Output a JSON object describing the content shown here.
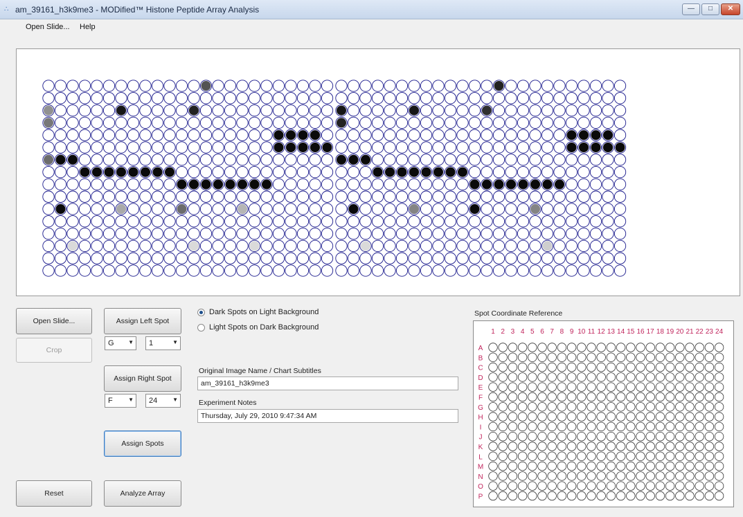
{
  "window": {
    "title": "am_39161_h3k9me3 - MODified™ Histone Peptide Array Analysis",
    "minimize_icon": "minimize-icon",
    "maximize_icon": "maximize-icon",
    "close_icon": "close-icon"
  },
  "menu": {
    "open_slide": "Open Slide...",
    "help": "Help"
  },
  "buttons": {
    "open_slide": "Open Slide...",
    "crop": "Crop",
    "assign_left_spot": "Assign Left Spot",
    "assign_right_spot": "Assign Right Spot",
    "assign_spots": "Assign Spots",
    "reset": "Reset",
    "analyze_array": "Analyze Array"
  },
  "selects": {
    "left_row": "G",
    "left_col": "1",
    "right_row": "F",
    "right_col": "24"
  },
  "radios": {
    "dark_spots": {
      "label": "Dark Spots on Light Background",
      "checked": true
    },
    "light_spots": {
      "label": "Light Spots on Dark Background",
      "checked": false
    }
  },
  "fields": {
    "image_name_label": "Original Image Name / Chart Subtitles",
    "image_name_value": "am_39161_h3k9me3",
    "notes_label": "Experiment Notes",
    "notes_value": "Thursday, July 29, 2010 9:47:34 AM"
  },
  "reference": {
    "title": "Spot Coordinate Reference",
    "columns": [
      "1",
      "2",
      "3",
      "4",
      "5",
      "6",
      "7",
      "8",
      "9",
      "10",
      "11",
      "12",
      "13",
      "14",
      "15",
      "16",
      "17",
      "18",
      "19",
      "20",
      "21",
      "22",
      "23",
      "24"
    ],
    "rows": [
      "A",
      "B",
      "C",
      "D",
      "E",
      "F",
      "G",
      "H",
      "I",
      "J",
      "K",
      "L",
      "M",
      "N",
      "O",
      "P"
    ],
    "label_color": "#c0245c"
  },
  "slide": {
    "rows": 16,
    "cols": 24,
    "ring_color": "#1a1a8c",
    "left_array_spots": [
      {
        "r": 0,
        "c": 13,
        "v": 0.7
      },
      {
        "r": 2,
        "c": 0,
        "v": 0.45
      },
      {
        "r": 2,
        "c": 6,
        "v": 0.95
      },
      {
        "r": 2,
        "c": 12,
        "v": 0.9
      },
      {
        "r": 3,
        "c": 0,
        "v": 0.55
      },
      {
        "r": 4,
        "c": 19,
        "v": 1
      },
      {
        "r": 4,
        "c": 20,
        "v": 1
      },
      {
        "r": 4,
        "c": 21,
        "v": 1
      },
      {
        "r": 4,
        "c": 22,
        "v": 1
      },
      {
        "r": 5,
        "c": 19,
        "v": 1
      },
      {
        "r": 5,
        "c": 20,
        "v": 1
      },
      {
        "r": 5,
        "c": 21,
        "v": 1
      },
      {
        "r": 5,
        "c": 22,
        "v": 1
      },
      {
        "r": 5,
        "c": 23,
        "v": 1
      },
      {
        "r": 6,
        "c": 0,
        "v": 0.6
      },
      {
        "r": 6,
        "c": 1,
        "v": 1
      },
      {
        "r": 6,
        "c": 2,
        "v": 1
      },
      {
        "r": 7,
        "c": 3,
        "v": 1
      },
      {
        "r": 7,
        "c": 4,
        "v": 1
      },
      {
        "r": 7,
        "c": 5,
        "v": 1
      },
      {
        "r": 7,
        "c": 6,
        "v": 1
      },
      {
        "r": 7,
        "c": 7,
        "v": 1
      },
      {
        "r": 7,
        "c": 8,
        "v": 1
      },
      {
        "r": 7,
        "c": 9,
        "v": 1
      },
      {
        "r": 7,
        "c": 10,
        "v": 1
      },
      {
        "r": 8,
        "c": 11,
        "v": 1
      },
      {
        "r": 8,
        "c": 12,
        "v": 1
      },
      {
        "r": 8,
        "c": 13,
        "v": 1
      },
      {
        "r": 8,
        "c": 14,
        "v": 1
      },
      {
        "r": 8,
        "c": 15,
        "v": 1
      },
      {
        "r": 8,
        "c": 16,
        "v": 1
      },
      {
        "r": 8,
        "c": 17,
        "v": 1
      },
      {
        "r": 8,
        "c": 18,
        "v": 1
      },
      {
        "r": 10,
        "c": 1,
        "v": 1
      },
      {
        "r": 10,
        "c": 6,
        "v": 0.35
      },
      {
        "r": 10,
        "c": 11,
        "v": 0.6
      },
      {
        "r": 10,
        "c": 16,
        "v": 0.3
      },
      {
        "r": 13,
        "c": 2,
        "v": 0.15
      },
      {
        "r": 13,
        "c": 12,
        "v": 0.15
      },
      {
        "r": 13,
        "c": 17,
        "v": 0.15
      }
    ],
    "right_array_spots": [
      {
        "r": 0,
        "c": 13,
        "v": 0.9
      },
      {
        "r": 2,
        "c": 0,
        "v": 0.95
      },
      {
        "r": 2,
        "c": 6,
        "v": 0.95
      },
      {
        "r": 2,
        "c": 12,
        "v": 0.85
      },
      {
        "r": 3,
        "c": 0,
        "v": 0.9
      },
      {
        "r": 4,
        "c": 19,
        "v": 1
      },
      {
        "r": 4,
        "c": 20,
        "v": 1
      },
      {
        "r": 4,
        "c": 21,
        "v": 1
      },
      {
        "r": 4,
        "c": 22,
        "v": 1
      },
      {
        "r": 5,
        "c": 19,
        "v": 1
      },
      {
        "r": 5,
        "c": 20,
        "v": 1
      },
      {
        "r": 5,
        "c": 21,
        "v": 1
      },
      {
        "r": 5,
        "c": 22,
        "v": 1
      },
      {
        "r": 5,
        "c": 23,
        "v": 1
      },
      {
        "r": 6,
        "c": 0,
        "v": 1
      },
      {
        "r": 6,
        "c": 1,
        "v": 1
      },
      {
        "r": 6,
        "c": 2,
        "v": 1
      },
      {
        "r": 7,
        "c": 3,
        "v": 1
      },
      {
        "r": 7,
        "c": 4,
        "v": 1
      },
      {
        "r": 7,
        "c": 5,
        "v": 1
      },
      {
        "r": 7,
        "c": 6,
        "v": 1
      },
      {
        "r": 7,
        "c": 7,
        "v": 1
      },
      {
        "r": 7,
        "c": 8,
        "v": 1
      },
      {
        "r": 7,
        "c": 9,
        "v": 1
      },
      {
        "r": 7,
        "c": 10,
        "v": 1
      },
      {
        "r": 8,
        "c": 11,
        "v": 1
      },
      {
        "r": 8,
        "c": 12,
        "v": 1
      },
      {
        "r": 8,
        "c": 13,
        "v": 1
      },
      {
        "r": 8,
        "c": 14,
        "v": 1
      },
      {
        "r": 8,
        "c": 15,
        "v": 1
      },
      {
        "r": 8,
        "c": 16,
        "v": 1
      },
      {
        "r": 8,
        "c": 17,
        "v": 1
      },
      {
        "r": 8,
        "c": 18,
        "v": 1
      },
      {
        "r": 10,
        "c": 1,
        "v": 1
      },
      {
        "r": 10,
        "c": 6,
        "v": 0.5
      },
      {
        "r": 10,
        "c": 11,
        "v": 1
      },
      {
        "r": 10,
        "c": 16,
        "v": 0.5
      },
      {
        "r": 13,
        "c": 2,
        "v": 0.15
      },
      {
        "r": 13,
        "c": 17,
        "v": 0.2
      }
    ]
  }
}
